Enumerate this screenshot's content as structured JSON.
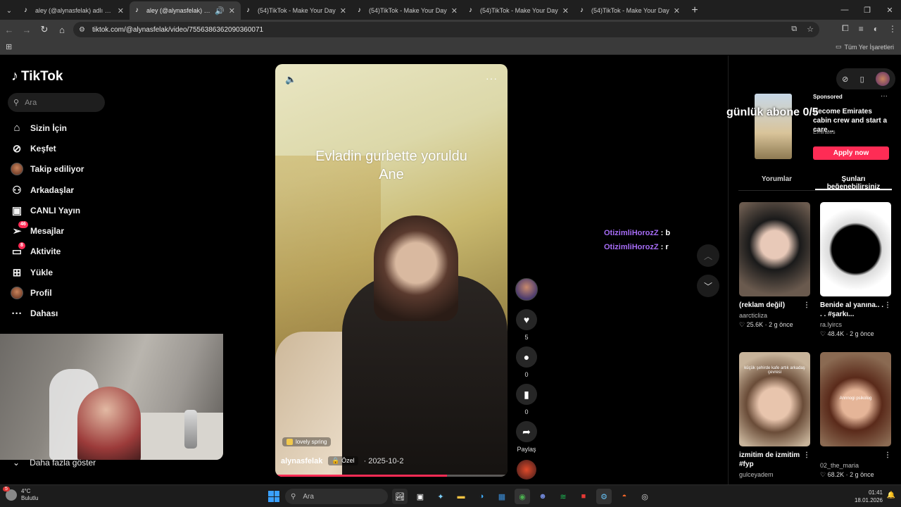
{
  "browser": {
    "tabs": [
      {
        "title": "aley (@alynasfelak) adlı kullanı",
        "active": false
      },
      {
        "title": "aley (@alynasfelak) adlı kull",
        "active": true
      },
      {
        "title": "(54)TikTok - Make Your Day",
        "active": false
      },
      {
        "title": "(54)TikTok - Make Your Day",
        "active": false
      },
      {
        "title": "(54)TikTok - Make Your Day",
        "active": false
      },
      {
        "title": "(54)TikTok - Make Your Day",
        "active": false
      }
    ],
    "url": "tiktok.com/@alynasfelak/video/7556386362090360071",
    "all_bookmarks": "Tüm Yer İşaretleri"
  },
  "sidebar": {
    "logo": "TikTok",
    "search_placeholder": "Ara",
    "items": [
      {
        "label": "Sizin İçin",
        "icon": "home-icon",
        "glyph": "⌂"
      },
      {
        "label": "Keşfet",
        "icon": "compass-icon",
        "glyph": "⊘"
      },
      {
        "label": "Takip ediliyor",
        "icon": "avatar-icon",
        "glyph": ""
      },
      {
        "label": "Arkadaşlar",
        "icon": "friends-icon",
        "glyph": "👥"
      },
      {
        "label": "CANLI Yayın",
        "icon": "live-tv-icon",
        "glyph": "▣"
      },
      {
        "label": "Mesajlar",
        "icon": "paper-plane-icon",
        "glyph": "➢",
        "badge": "46"
      },
      {
        "label": "Aktivite",
        "icon": "inbox-icon",
        "glyph": "▭",
        "badge": "8"
      },
      {
        "label": "Yükle",
        "icon": "upload-plus-icon",
        "glyph": "⊞"
      },
      {
        "label": "Profil",
        "icon": "profile-avatar-icon",
        "glyph": ""
      },
      {
        "label": "Dahası",
        "icon": "more-dots-icon",
        "glyph": "···"
      }
    ],
    "show_more": "Daha fazla göster"
  },
  "video": {
    "caption_line1": "Evladin gurbette yoruldu",
    "caption_line2": "Ane",
    "music": "lovely spring",
    "username": "alynasfelak",
    "privacy": "Özel",
    "date": "· 2025-10-2",
    "progress": 0.74
  },
  "actions": {
    "likes": "5",
    "comments": "0",
    "saves": "0",
    "share": "Paylaş"
  },
  "chat": [
    {
      "nick": "OtizimliHorozZ",
      "msg": ": b"
    },
    {
      "nick": "OtizimliHorozZ",
      "msg": ": r"
    }
  ],
  "overlay": "günlük abone 0/5",
  "ad": {
    "sponsored": "Sponsored",
    "desc": "Become Emirates cabin crew and start a care...",
    "brand": "Emirates",
    "cta": "Apply now"
  },
  "right_tabs": [
    "Yorumlar",
    "Şunları beğenebilirsiniz"
  ],
  "cards": [
    {
      "title": "(reklam değil)",
      "author": "aarcticliza",
      "stats": "♡ 25.6K · 2 g önce",
      "thumb_text": ""
    },
    {
      "title": "Benide al yanına.. . . . #şarkı...",
      "author": "ra.lyircs",
      "stats": "♡ 48.4K · 2 g önce",
      "thumb_text": ""
    },
    {
      "title": "izmitim de izmitim #fyp",
      "author": "gulceyadem",
      "stats": "",
      "thumb_text": "küçük şehirde kafe artık arkadaş çevresi"
    },
    {
      "title": "",
      "author": "02_the_maria",
      "stats": "♡ 68.2K · 2 g önce",
      "thumb_text": "Annnogi psikolog"
    }
  ],
  "taskbar": {
    "weather_temp": "4°C",
    "weather_desc": "Bulutlu",
    "weather_badge": "5",
    "search": "Ara",
    "time": "01:41",
    "date": "18.01.2026"
  },
  "colors": {
    "accent": "#fe2c55",
    "chat_nick": "#a66cf5"
  }
}
